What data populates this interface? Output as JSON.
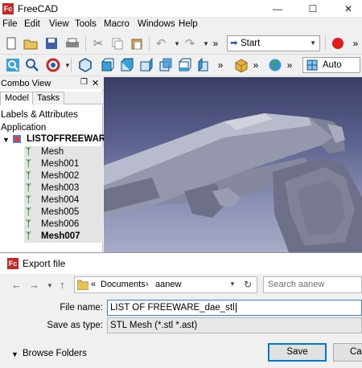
{
  "window": {
    "title": "FreeCAD",
    "app_icon": "Fc"
  },
  "menu": [
    "File",
    "Edit",
    "View",
    "Tools",
    "Macro",
    "Windows",
    "Help"
  ],
  "toolbar": {
    "workbench": "Start",
    "view_mode": "Auto",
    "more": "»"
  },
  "combo_view": {
    "title": "Combo View",
    "tabs": [
      "Model",
      "Tasks"
    ],
    "labels_header": "Labels & Attributes",
    "application": "Application",
    "document": "LISTOFFREEWARE_",
    "items": [
      "Mesh",
      "Mesh001",
      "Mesh002",
      "Mesh003",
      "Mesh004",
      "Mesh005",
      "Mesh006",
      "Mesh007"
    ]
  },
  "dialog": {
    "title": "Export file",
    "breadcrumb": {
      "sep": "«",
      "parent": "Documents",
      "arrow": "›",
      "current": "aanew"
    },
    "search_placeholder": "Search aanew",
    "file_name_label": "File name:",
    "file_name_value": "LIST OF FREEWARE_dae_stl",
    "save_type_label": "Save as type:",
    "save_type_value": "STL Mesh (*.stl *.ast)",
    "browse_folders": "Browse Folders",
    "save": "Save",
    "cancel": "Ca"
  },
  "colors": {
    "accent": "#c62828",
    "mesh_icon": "#2e8b2e",
    "viewport_top": "#3a3e66",
    "viewport_bottom": "#a8acc8"
  }
}
